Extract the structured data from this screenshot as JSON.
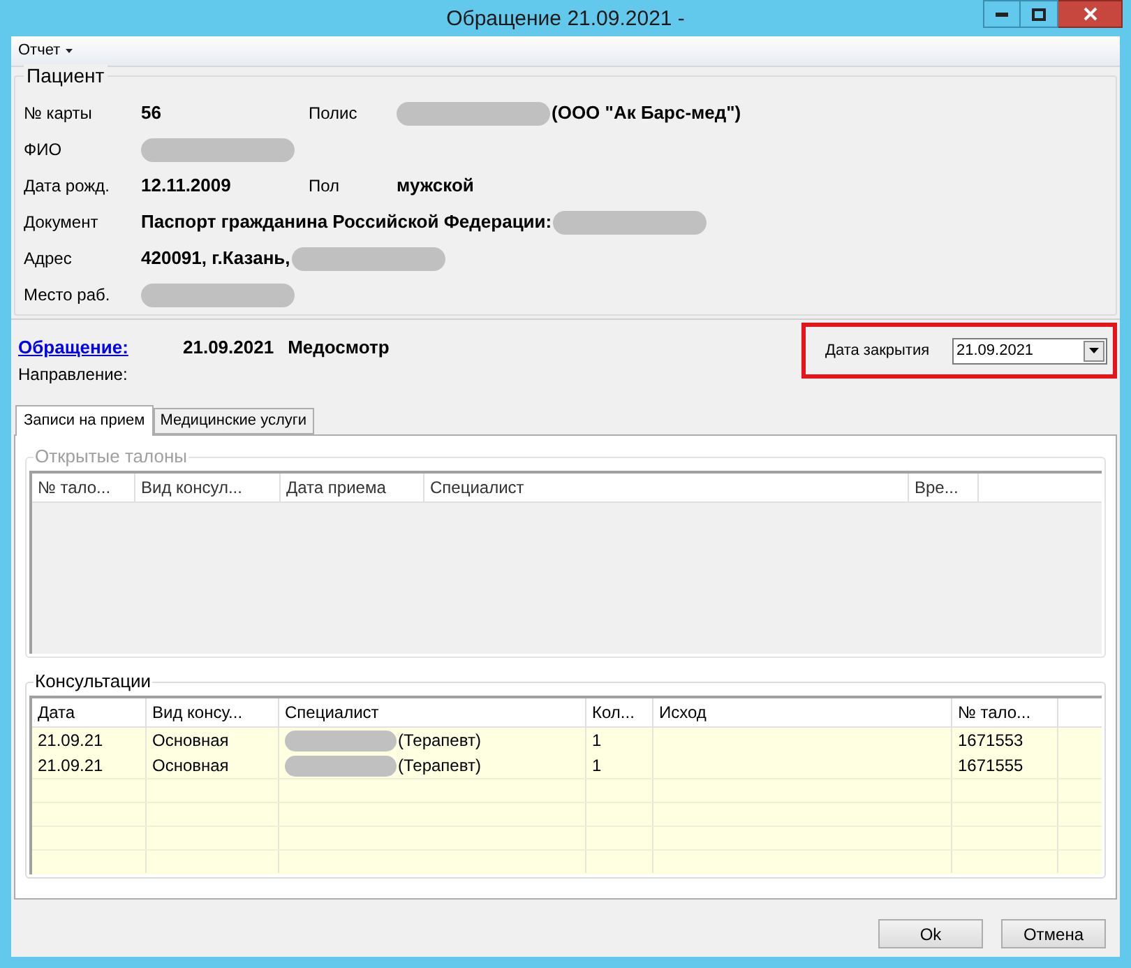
{
  "window": {
    "title": "Обращение 21.09.2021 -"
  },
  "menu": [
    {
      "label": "Отчет"
    }
  ],
  "patient": {
    "title": "Пациент",
    "rows": [
      {
        "label": "№ карты",
        "value": [
          {
            "kind": "text",
            "text": "56"
          }
        ],
        "label_2": "Полис",
        "value_2": [
          {
            "kind": "redacted"
          },
          {
            "kind": "text",
            "text": "(ООО \"Ак Барс-мед\")"
          }
        ]
      },
      {
        "label": "ФИО",
        "value": [
          {
            "kind": "redacted"
          }
        ]
      },
      {
        "label": "Дата рожд.",
        "value": [
          {
            "kind": "text",
            "text": "12.11.2009"
          }
        ],
        "label_2": "Пол",
        "value_2": [
          {
            "kind": "text",
            "text": "мужской"
          }
        ]
      },
      {
        "label": "Документ",
        "value": [
          {
            "kind": "text",
            "text": "Паспорт гражданина Российской Федерации:"
          },
          {
            "kind": "redacted"
          }
        ]
      },
      {
        "label": "Адрес",
        "value": [
          {
            "kind": "text",
            "text": "420091, г.Казань,"
          },
          {
            "kind": "redacted"
          }
        ]
      },
      {
        "label": "Место раб.",
        "value": [
          {
            "kind": "redacted"
          }
        ]
      }
    ]
  },
  "appeal": {
    "link": "Обращение:",
    "date": "21.09.2021",
    "type": "Медосмотр",
    "direction_label": "Направление:"
  },
  "close_date": {
    "label": "Дата закрытия",
    "value": "21.09.2021",
    "highlighted": true
  },
  "tabs": [
    {
      "label": "Записи на прием",
      "selected": true
    },
    {
      "label": "Медицинские услуги",
      "selected": false
    }
  ],
  "open_tickets": {
    "title": "Открытые талоны",
    "disabled": true,
    "columns": [
      "№ тало...",
      "Вид консул...",
      "Дата приема",
      "Специалист",
      "Вре..."
    ]
  },
  "consultations": {
    "title": "Консультации",
    "disabled": false,
    "columns": [
      "Дата",
      "Вид консу...",
      "Специалист",
      "Кол...",
      "Исход",
      "№ тало..."
    ],
    "rows": [
      {
        "cells": [
          [
            {
              "kind": "text",
              "text": "21.09.21"
            }
          ],
          [
            {
              "kind": "text",
              "text": "Основная"
            }
          ],
          [
            {
              "kind": "redacted"
            },
            {
              "kind": "text",
              "text": "(Терапевт)"
            }
          ],
          [
            {
              "kind": "text",
              "text": "1"
            }
          ],
          [],
          [
            {
              "kind": "text",
              "text": "1671553"
            }
          ]
        ]
      },
      {
        "cells": [
          [
            {
              "kind": "text",
              "text": "21.09.21"
            }
          ],
          [
            {
              "kind": "text",
              "text": "Основная"
            }
          ],
          [
            {
              "kind": "redacted"
            },
            {
              "kind": "text",
              "text": "(Терапевт)"
            }
          ],
          [
            {
              "kind": "text",
              "text": "1"
            }
          ],
          [],
          [
            {
              "kind": "text",
              "text": "1671555"
            }
          ]
        ]
      }
    ]
  },
  "buttons": [
    "Ok",
    "Отмена"
  ]
}
